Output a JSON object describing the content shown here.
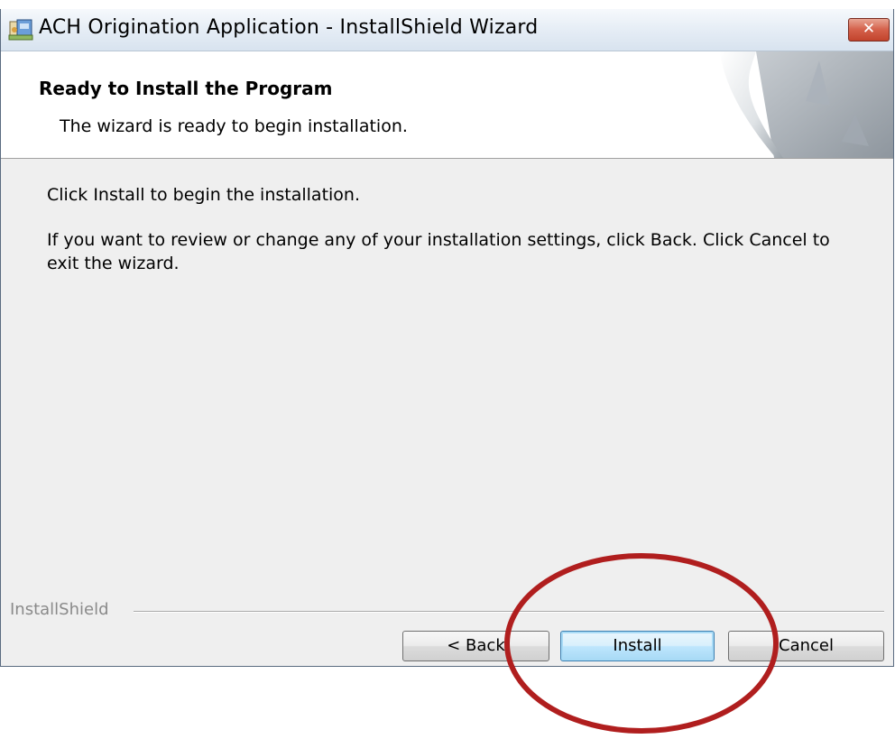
{
  "window": {
    "title": "ACH Origination Application - InstallShield Wizard",
    "close_glyph": "✕"
  },
  "header": {
    "title": "Ready to Install the Program",
    "subtitle": "The wizard is ready to begin installation."
  },
  "body": {
    "line1": "Click Install to begin the installation.",
    "line2": "If you want to review or change any of your installation settings, click Back. Click Cancel to exit the wizard."
  },
  "footer": {
    "brand": "InstallShield",
    "back_label": "< Back",
    "install_label": "Install",
    "cancel_label": "Cancel"
  },
  "colors": {
    "annotation_circle": "#b01e1e",
    "dialog_background": "#efefef"
  },
  "icons": [
    "installer-icon",
    "close-icon",
    "banner-art"
  ]
}
